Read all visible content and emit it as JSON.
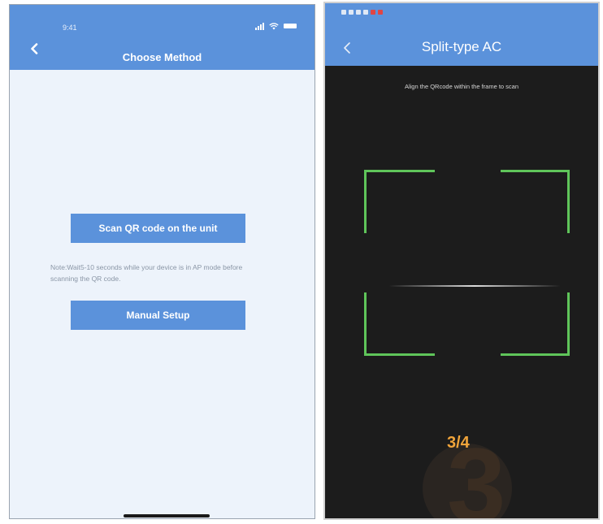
{
  "left_screen": {
    "status_time": "9:41",
    "title": "Choose Method",
    "scan_button_label": "Scan QR code on the unit",
    "note_text": "Note:Wait5-10 seconds while your device is in AP mode before scanning the QR code.",
    "manual_button_label": "Manual Setup",
    "colors": {
      "header": "#5b92db",
      "background": "#edf3fb",
      "button": "#5b92db"
    },
    "icons": [
      "back-chevron-icon",
      "signal-icon",
      "wifi-icon",
      "battery-icon"
    ]
  },
  "right_screen": {
    "title": "Split-type AC",
    "instruction": "Align the QRcode within the frame to scan",
    "step_counter": "3/4",
    "step_background_digit": "3",
    "colors": {
      "header": "#5b92db",
      "viewfinder": "#5fc55a",
      "camera_bg": "#1c1c1c",
      "step_text": "#f0a43a"
    },
    "icons": [
      "back-chevron-icon",
      "scan-frame-corners",
      "scan-line"
    ]
  }
}
